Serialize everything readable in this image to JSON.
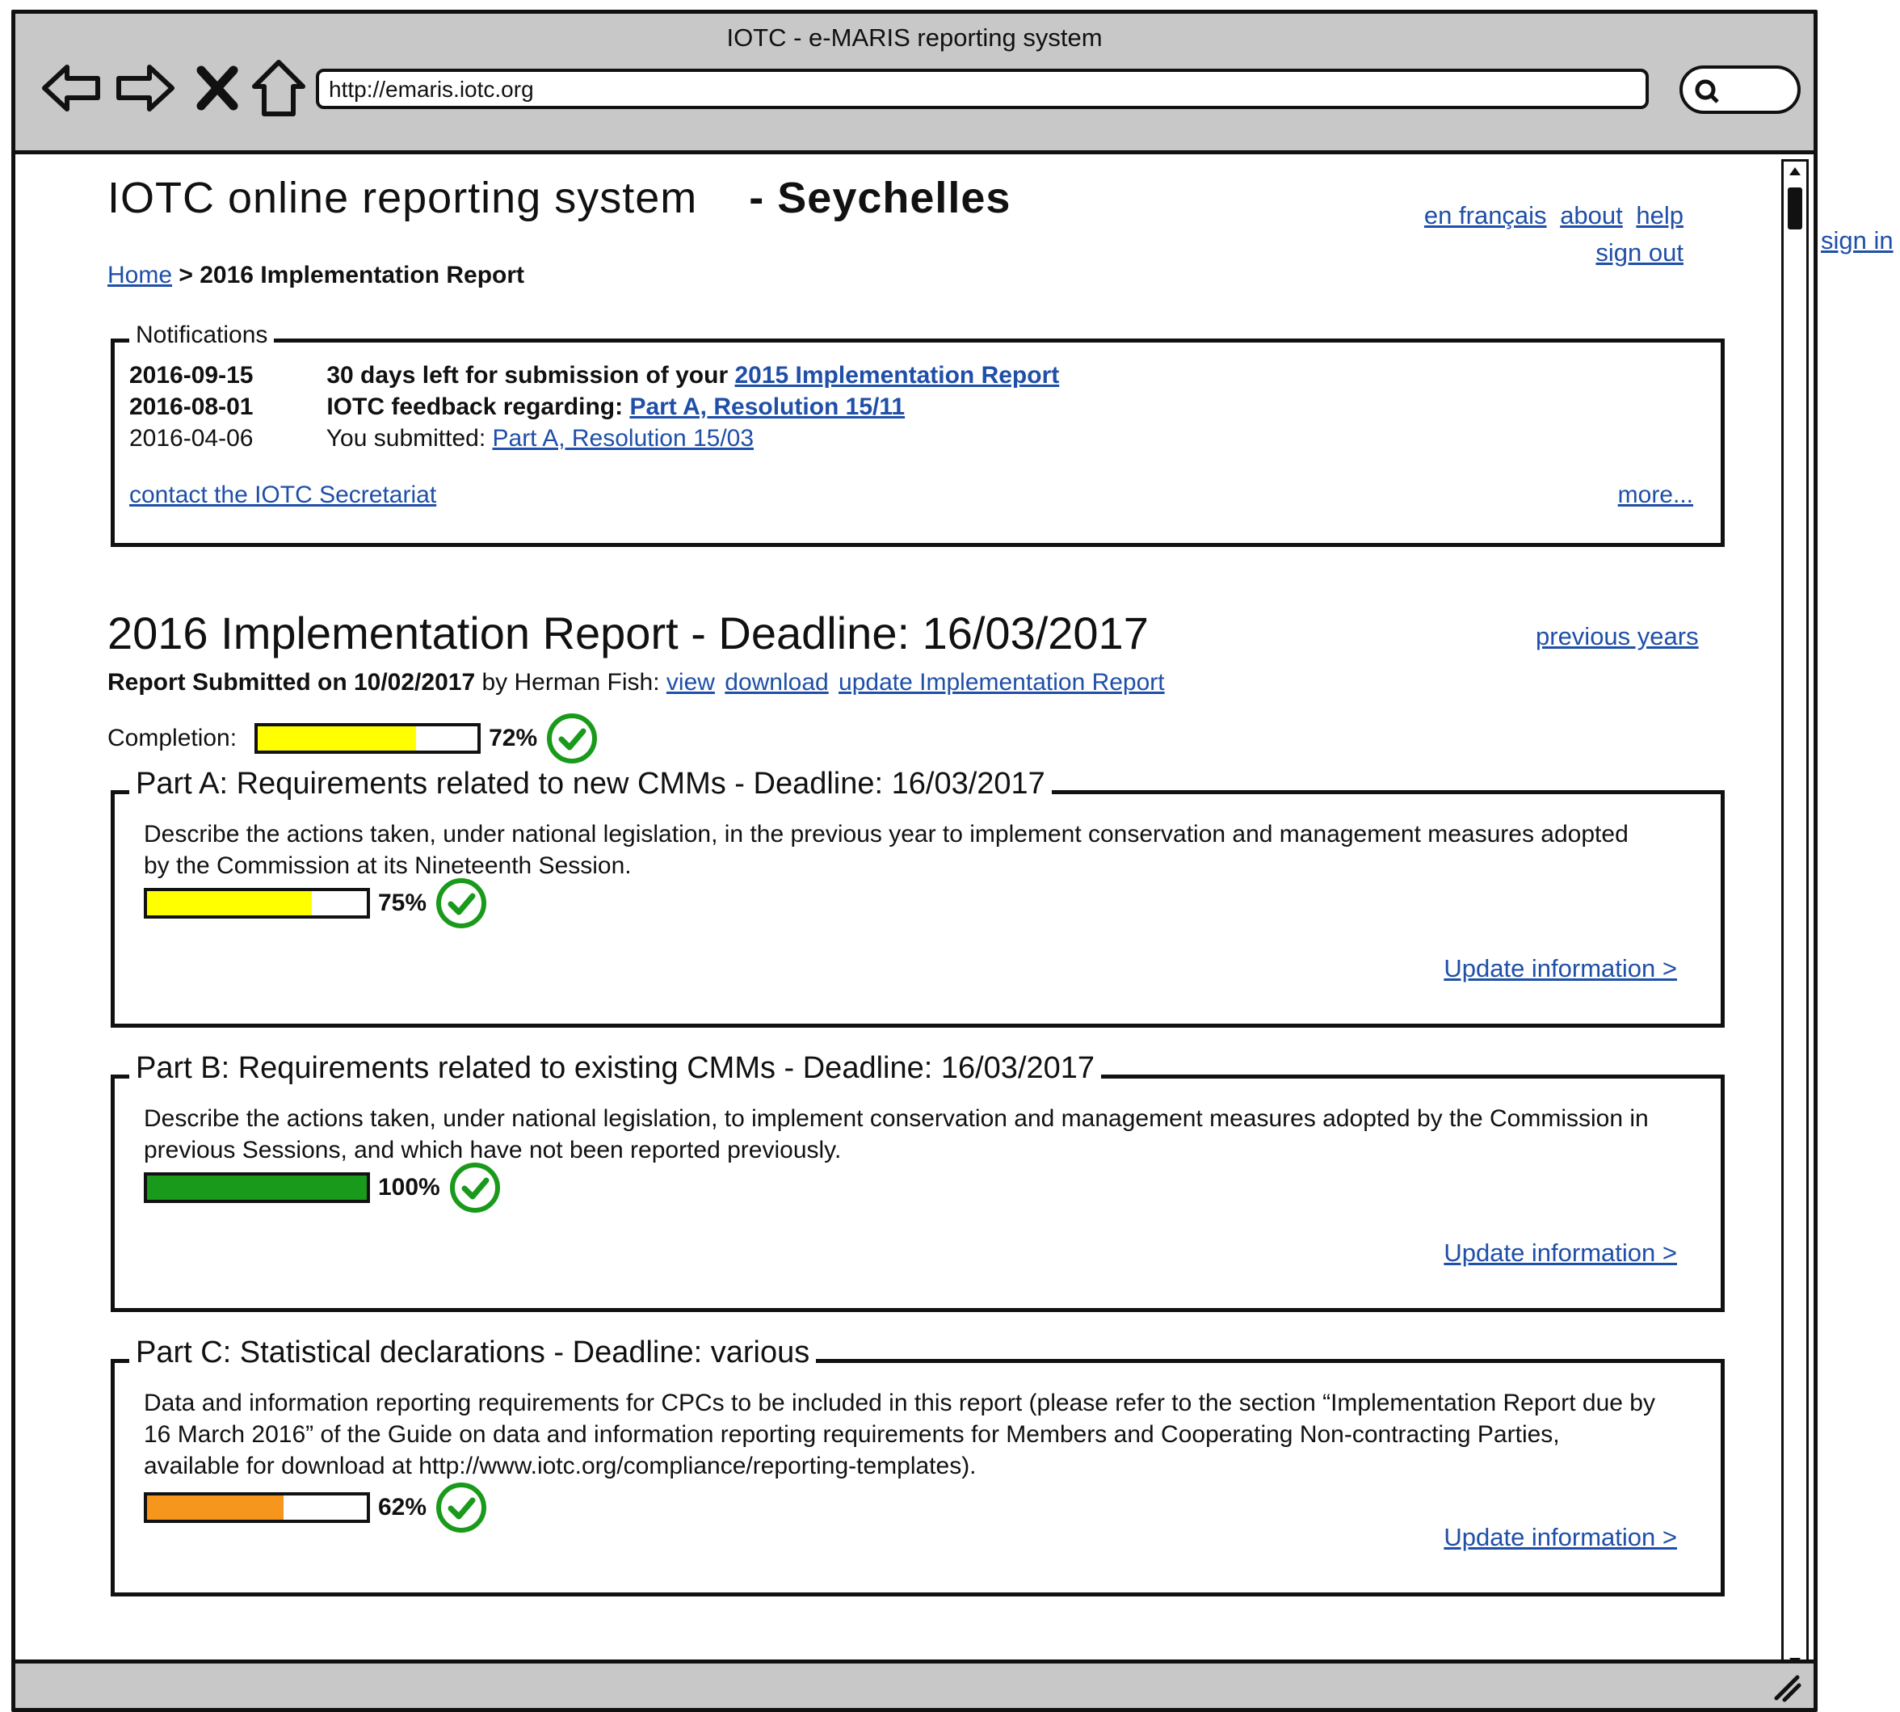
{
  "browser": {
    "window_title": "IOTC - e-MARIS reporting system",
    "url": "http://emaris.iotc.org"
  },
  "outside": {
    "sign_in": "sign in"
  },
  "header": {
    "title": "IOTC online reporting system",
    "country": "- Seychelles",
    "links": {
      "lang": "en français",
      "about": "about",
      "help": "help",
      "sign_out": "sign out"
    }
  },
  "breadcrumb": {
    "home": "Home",
    "separator": ">",
    "current": "2016 Implementation Report"
  },
  "notifications": {
    "legend": "Notifications",
    "items": [
      {
        "date": "2016-09-15",
        "text": "30 days left for submission of your",
        "link": "2015 Implementation Report",
        "bold": true
      },
      {
        "date": "2016-08-01",
        "text": "IOTC feedback regarding:",
        "link": "Part A, Resolution 15/11",
        "bold": true
      },
      {
        "date": "2016-04-06",
        "text": "You submitted:",
        "link": "Part A, Resolution 15/03",
        "bold": false
      }
    ],
    "contact": "contact the IOTC Secretariat",
    "more": "more..."
  },
  "report": {
    "title": "2016 Implementation Report - Deadline: 16/03/2017",
    "previous_years": "previous years",
    "submitted_bold": "Report Submitted on 10/02/2017",
    "submitted_by": "by Herman Fish:",
    "view": "view",
    "download": "download",
    "update": "update Implementation Report",
    "completion_label": "Completion:",
    "completion_pct": "72%",
    "completion_value": 0.72,
    "completion_color": "#ffff00"
  },
  "parts": [
    {
      "legend": "Part A: Requirements related to new CMMs - Deadline: 16/03/2017",
      "description": "Describe the actions taken, under national legislation, in the previous year to implement conservation and management measures adopted by the Commission at its Nineteenth Session.",
      "pct": "75%",
      "value": 0.75,
      "color": "#ffff00",
      "update": "Update information >"
    },
    {
      "legend": "Part B: Requirements related to existing CMMs - Deadline: 16/03/2017",
      "description": "Describe the actions taken, under national legislation, to implement conservation and management measures adopted by the Commission in previous Sessions, and which have not been reported previously.",
      "pct": "100%",
      "value": 1.0,
      "color": "#1a9a1a",
      "update": "Update information >"
    },
    {
      "legend": "Part C: Statistical declarations - Deadline: various",
      "description": "Data and information reporting requirements for CPCs to be included in this report (please refer to the section “Implementation Report due by 16 March 2016” of the Guide on data and information reporting requirements for Members and Cooperating Non-contracting Parties, available for download at http://www.iotc.org/compliance/reporting-templates).",
      "pct": "62%",
      "value": 0.62,
      "color": "#f7961d",
      "update": "Update information >"
    }
  ]
}
